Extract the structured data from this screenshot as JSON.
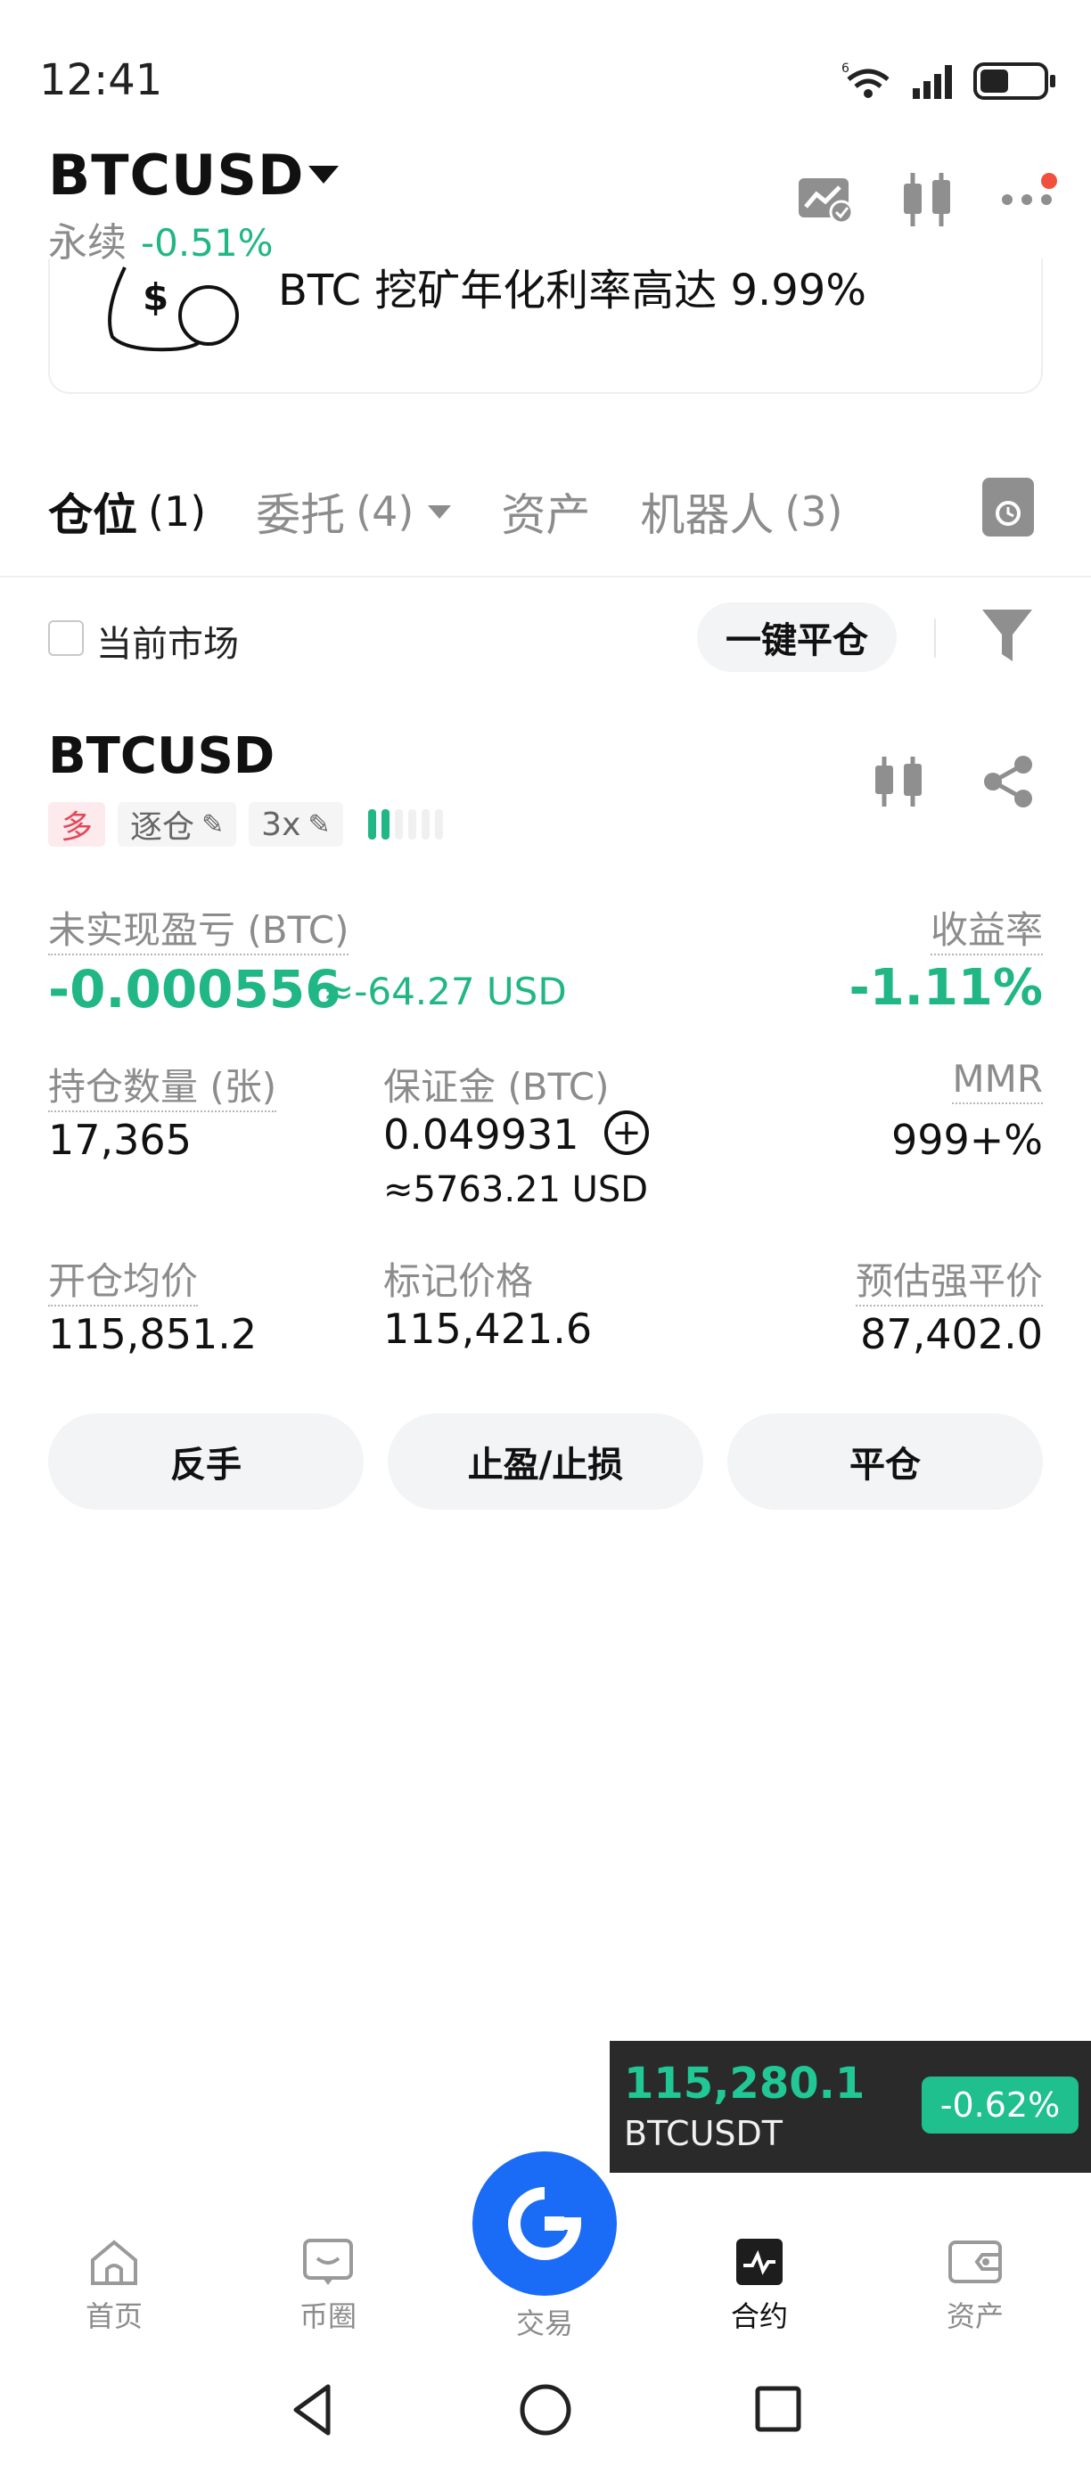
{
  "status_bar": {
    "time": "12:41",
    "network_label": "6",
    "battery_level": 0.45
  },
  "header": {
    "pair": "BTCUSD",
    "type": "永续",
    "change": "-0.51%"
  },
  "banner": {
    "text": "BTC 挖矿年化利率高达 9.99%"
  },
  "tabs": [
    {
      "label": "仓位",
      "count": "(1)",
      "active": true
    },
    {
      "label": "委托",
      "count": "(4)",
      "active": false,
      "dropdown": true
    },
    {
      "label": "资产",
      "count": "",
      "active": false
    },
    {
      "label": "机器人",
      "count": "(3)",
      "active": false
    }
  ],
  "filter": {
    "current_market_label": "当前市场",
    "close_all_label": "一键平仓"
  },
  "position": {
    "symbol": "BTCUSD",
    "side": "多",
    "margin_mode": "逐仓",
    "leverage": "3x",
    "pnl_label": "未实现盈亏 (BTC)",
    "pnl_value": "-0.000556",
    "pnl_usd": "≈-64.27 USD",
    "roe_label": "收益率",
    "roe_value": "-1.11%",
    "size_label": "持仓数量 (张)",
    "size_value": "17,365",
    "margin_label": "保证金 (BTC)",
    "margin_value": "0.049931",
    "margin_usd": "≈5763.21 USD",
    "mmr_label": "MMR",
    "mmr_value": "999+%",
    "entry_label": "开仓均价",
    "entry_value": "115,851.2",
    "mark_label": "标记价格",
    "mark_value": "115,421.6",
    "liq_label": "预估强平价",
    "liq_value": "87,402.0",
    "risk_bars_filled": 2,
    "risk_bars_total": 6
  },
  "actions": {
    "reverse": "反手",
    "tpsl": "止盈/止损",
    "close": "平仓"
  },
  "ticker": {
    "price": "115,280.1",
    "symbol": "BTCUSDT",
    "change": "-0.62%"
  },
  "nav": [
    {
      "label": "首页",
      "icon": "home-icon"
    },
    {
      "label": "币圈",
      "icon": "community-icon"
    },
    {
      "label": "交易",
      "icon": "trade-icon"
    },
    {
      "label": "合约",
      "icon": "futures-icon",
      "active": true
    },
    {
      "label": "资产",
      "icon": "wallet-icon"
    }
  ],
  "colors": {
    "green": "#21b685",
    "red": "#e5475a",
    "orange": "#f0923a",
    "brand_blue": "#1a6bf5"
  }
}
